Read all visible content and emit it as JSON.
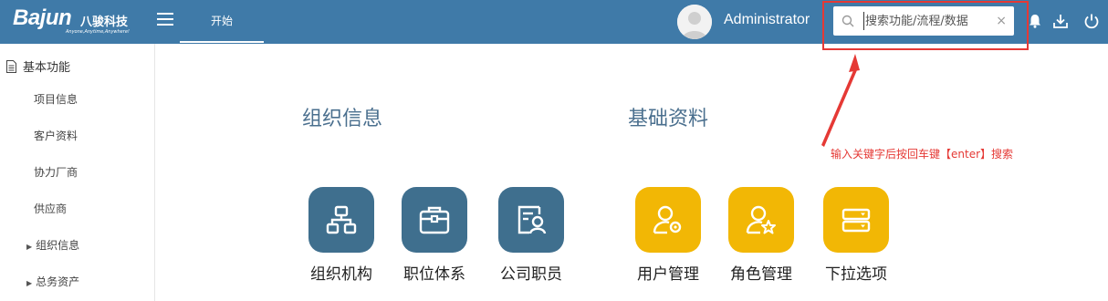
{
  "header": {
    "logo_brand": "Bajun",
    "logo_cn": "八骏科技",
    "logo_slogan": "Anyone,Anytime,Anywhere!",
    "tab_start": "开始",
    "username": "Administrator",
    "search_placeholder": "搜索功能/流程/数据",
    "clear_glyph": "×"
  },
  "sidebar": {
    "section_label": "基本功能",
    "items": [
      {
        "label": "项目信息",
        "expandable": false
      },
      {
        "label": "客户资料",
        "expandable": false
      },
      {
        "label": "协力厂商",
        "expandable": false
      },
      {
        "label": "供应商",
        "expandable": false
      },
      {
        "label": "组织信息",
        "expandable": true
      },
      {
        "label": "总务资产",
        "expandable": true
      }
    ]
  },
  "main": {
    "groups": [
      {
        "title": "组织信息",
        "tiles": [
          {
            "label": "组织机构",
            "icon": "org-structure-icon"
          },
          {
            "label": "职位体系",
            "icon": "briefcase-icon"
          },
          {
            "label": "公司职员",
            "icon": "employee-card-icon"
          }
        ]
      },
      {
        "title": "基础资料",
        "tiles": [
          {
            "label": "用户管理",
            "icon": "user-gear-icon"
          },
          {
            "label": "角色管理",
            "icon": "user-star-icon"
          },
          {
            "label": "下拉选项",
            "icon": "dropdown-list-icon"
          }
        ]
      }
    ]
  },
  "annotation": {
    "text": "输入关键字后按回车键【enter】搜索"
  },
  "colors": {
    "topbar": "#3f7aa8",
    "tile_blue": "#3f6f8e",
    "tile_yellow": "#f2b705",
    "annotation_red": "#e53935"
  }
}
